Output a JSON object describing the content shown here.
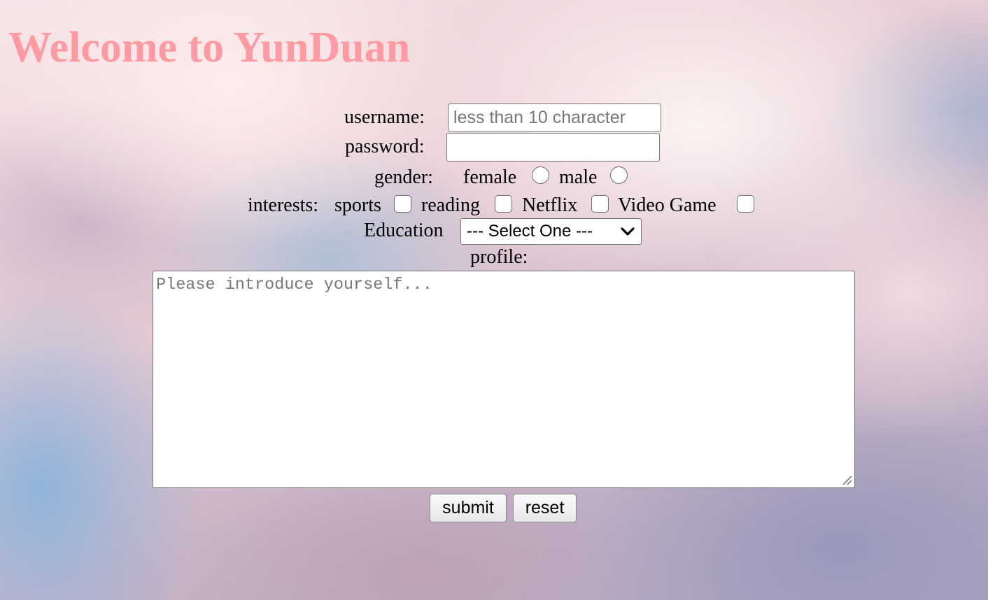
{
  "page": {
    "title": "Welcome to YunDuan"
  },
  "form": {
    "username": {
      "label": "username:",
      "placeholder": "less than 10 character",
      "value": ""
    },
    "password": {
      "label": "password:",
      "value": ""
    },
    "gender": {
      "label": "gender:",
      "options": [
        {
          "label": "female",
          "checked": false
        },
        {
          "label": "male",
          "checked": false
        }
      ]
    },
    "interests": {
      "label": "interests:",
      "options": [
        {
          "label": "sports",
          "checked": false
        },
        {
          "label": "reading",
          "checked": false
        },
        {
          "label": "Netflix",
          "checked": false
        },
        {
          "label": "Video Game",
          "checked": false
        }
      ]
    },
    "education": {
      "label": "Education",
      "selected": "--- Select One ---"
    },
    "profile": {
      "label": "profile:",
      "placeholder": "Please introduce yourself...",
      "value": ""
    },
    "buttons": {
      "submit": "submit",
      "reset": "reset"
    }
  },
  "colors": {
    "title": "#ff9aa2",
    "background_top": "#f6e5e8",
    "background_bottom": "#a9a3c0"
  },
  "icons": {
    "education_select": "chevron-down-icon",
    "profile_textarea": "resize-grip-icon"
  }
}
